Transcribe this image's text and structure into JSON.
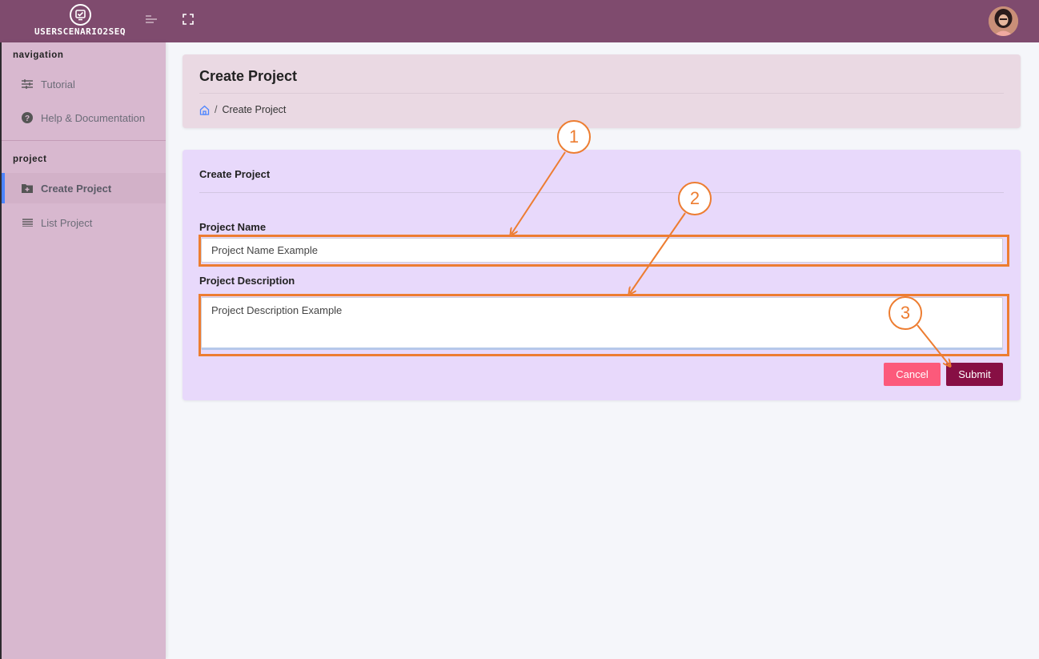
{
  "header": {
    "brand_name": "USERSCENARIO2SEQ"
  },
  "sidebar": {
    "sections": [
      {
        "title": "navigation",
        "items": [
          {
            "label": "Tutorial",
            "icon": "sliders-icon"
          },
          {
            "label": "Help & Documentation",
            "icon": "question-circle-icon"
          }
        ]
      },
      {
        "title": "project",
        "items": [
          {
            "label": "Create Project",
            "icon": "folder-plus-icon",
            "active": true
          },
          {
            "label": "List Project",
            "icon": "list-icon"
          }
        ]
      }
    ]
  },
  "page": {
    "title": "Create Project",
    "breadcrumb": [
      "Create Project"
    ]
  },
  "form": {
    "title": "Create Project",
    "project_name_label": "Project Name",
    "project_name_value": "Project Name Example",
    "project_description_label": "Project Description",
    "project_description_value": "Project Description Example",
    "cancel_label": "Cancel",
    "submit_label": "Submit"
  },
  "annotations": {
    "markers": [
      "1",
      "2",
      "3"
    ],
    "color": "#ed7d31"
  },
  "colors": {
    "topbar": "#7f4b6e",
    "sidebar": "#d8b8cf",
    "cancel": "#fc5a7b",
    "submit": "#870f44",
    "form_card": "#e8d9fb",
    "active_indicator": "#4c84ff"
  }
}
